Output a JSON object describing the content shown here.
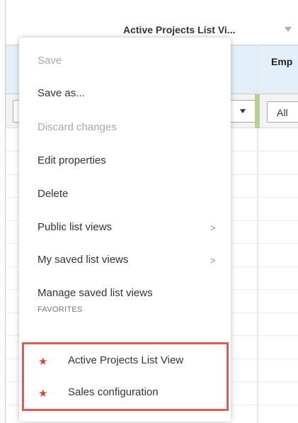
{
  "toolbar": {
    "view_title": "Active Projects List Vi...",
    "view_caret_icon": "caret-down-icon"
  },
  "grid": {
    "column_header": "Emp",
    "filter_value": "All",
    "filter_caret_icon": "caret-down-icon"
  },
  "menu": {
    "items": [
      {
        "label": "Save",
        "enabled": false
      },
      {
        "label": "Save as...",
        "enabled": true
      },
      {
        "label": "Discard changes",
        "enabled": false
      },
      {
        "label": "Edit properties",
        "enabled": true
      },
      {
        "label": "Delete",
        "enabled": true
      },
      {
        "label": "Public list views",
        "enabled": true,
        "submenu": true
      },
      {
        "label": "My saved list views",
        "enabled": true,
        "submenu": true
      },
      {
        "label": "Manage saved list views",
        "enabled": true
      }
    ],
    "submenu_chevron": ">",
    "favorites_label": "FAVORITES",
    "favorites": [
      {
        "label": "Active Projects List View",
        "icon": "star-icon"
      },
      {
        "label": "Sales configuration",
        "icon": "star-icon"
      }
    ],
    "star_glyph": "★",
    "colors": {
      "star": "#e43c3c",
      "highlight_border": "#e05a5a",
      "header_bg": "#e4f0f9",
      "disabled_text": "#a9a9a9"
    }
  }
}
